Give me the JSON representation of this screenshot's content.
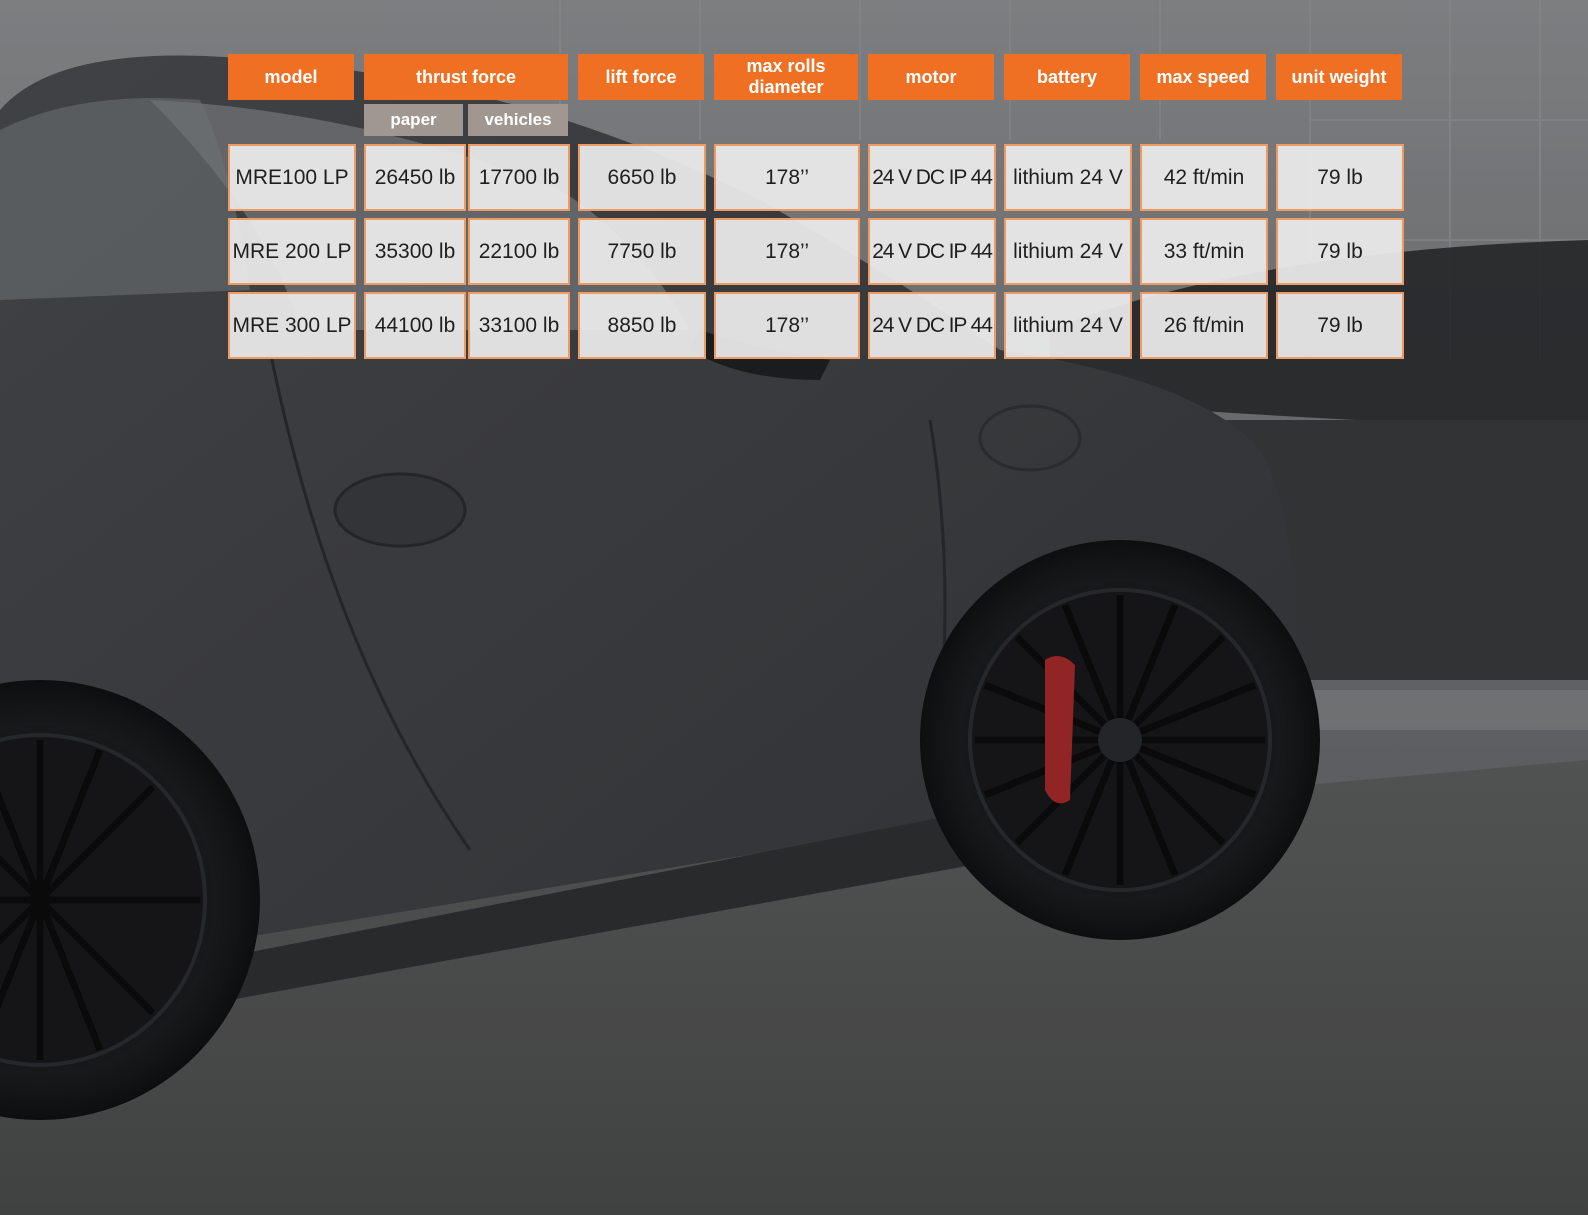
{
  "colors": {
    "header_orange": "#ef7023",
    "subheader_taupe": "#a09790",
    "cell_border": "#ee9a63",
    "cell_fill": "#ececec"
  },
  "table": {
    "headers": {
      "model": "model",
      "thrust_force": "thrust force",
      "lift_force": "lift force",
      "max_rolls_diameter_line1": "max rolls",
      "max_rolls_diameter_line2": "diameter",
      "motor": "motor",
      "battery": "battery",
      "max_speed": "max speed",
      "unit_weight": "unit weight"
    },
    "subheaders": {
      "paper": "paper",
      "vehicles": "vehicles"
    },
    "rows": [
      {
        "model": "MRE100 LP",
        "thrust_paper": "26450 lb",
        "thrust_vehicles": "17700 lb",
        "lift_force": "6650 lb",
        "max_rolls_diameter": "178’’",
        "motor": "24 V DC IP 44",
        "battery": "lithium 24 V",
        "max_speed": "42 ft/min",
        "unit_weight": "79 lb"
      },
      {
        "model": "MRE 200 LP",
        "thrust_paper": "35300 lb",
        "thrust_vehicles": "22100 lb",
        "lift_force": "7750 lb",
        "max_rolls_diameter": "178’’",
        "motor": "24 V DC IP 44",
        "battery": "lithium 24 V",
        "max_speed": "33 ft/min",
        "unit_weight": "79 lb"
      },
      {
        "model": "MRE 300 LP",
        "thrust_paper": "44100 lb",
        "thrust_vehicles": "33100 lb",
        "lift_force": "8850 lb",
        "max_rolls_diameter": "178’’",
        "motor": "24 V DC IP 44",
        "battery": "lithium 24 V",
        "max_speed": "26 ft/min",
        "unit_weight": "79 lb"
      }
    ]
  }
}
